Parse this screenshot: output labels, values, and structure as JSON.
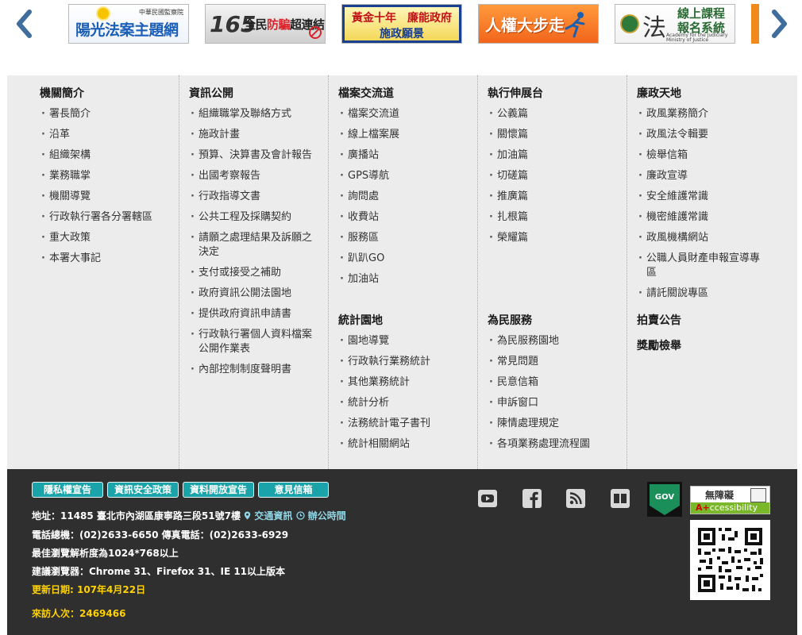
{
  "carousel": {
    "prev_icon": "chevron-left-icon",
    "next_icon": "chevron-right-icon",
    "arrow_color": "#3f6d9c",
    "banners": [
      {
        "small": "中華民國監察院",
        "main": "陽光法案主題網"
      },
      {
        "num": "165",
        "main_a": "全民",
        "main_b": "防騙",
        "main_c": "超連結"
      },
      {
        "line1": "黃金十年　廉能政府",
        "line2": "施政願景"
      },
      {
        "main": "人權大步走"
      },
      {
        "law": "法",
        "title": "線上課程",
        "title2": "報名系統",
        "en1": "Academy for the Judiciary",
        "en2": "Ministry of Justice"
      }
    ]
  },
  "sitemap": {
    "columns": [
      {
        "groups": [
          {
            "heading": "機關簡介",
            "items": [
              "署長簡介",
              "沿革",
              "組織架構",
              "業務職掌",
              "機關導覽",
              "行政執行署各分署轄區",
              "重大政策",
              "本署大事記"
            ]
          }
        ]
      },
      {
        "groups": [
          {
            "heading": "資訊公開",
            "items": [
              "組織職掌及聯絡方式",
              "施政計畫",
              "預算、決算書及會計報告",
              "出國考察報告",
              "行政指導文書",
              "公共工程及採購契約",
              "請願之處理結果及訴願之決定",
              "支付或接受之補助",
              "政府資訊公開法園地",
              "提供政府資訊申請書",
              "行政執行署個人資料檔案公開作業表",
              "內部控制制度聲明書"
            ]
          }
        ]
      },
      {
        "groups": [
          {
            "heading": "檔案交流道",
            "items": [
              "檔案交流道",
              "線上檔案展",
              "廣播站",
              "GPS導航",
              "詢問處",
              "收費站",
              "服務區",
              "趴趴GO",
              "加油站"
            ]
          },
          {
            "heading": "統計園地",
            "items": [
              "園地導覽",
              "行政執行業務統計",
              "其他業務統計",
              "統計分析",
              "法務統計電子書刊",
              "統計相關網站"
            ]
          }
        ]
      },
      {
        "groups": [
          {
            "heading": "執行伸展台",
            "items": [
              "公義篇",
              "關懷篇",
              "加油篇",
              "切磋篇",
              "推廣篇",
              "扎根篇",
              "榮耀篇"
            ]
          },
          {
            "heading": "為民服務",
            "items": [
              "為民服務園地",
              "常見問題",
              "民意信箱",
              "申訴窗口",
              "陳情處理規定",
              "各項業務處理流程圖"
            ]
          }
        ]
      },
      {
        "groups": [
          {
            "heading": "廉政天地",
            "items": [
              "政風業務簡介",
              "政風法令輯要",
              "檢舉信箱",
              "廉政宣導",
              "安全維護常識",
              "機密維護常識",
              "政風機構網站",
              "公職人員財產申報宣導專區",
              "請託關說專區"
            ]
          },
          {
            "heading": "拍賣公告",
            "items": []
          },
          {
            "heading": "獎勵檢舉",
            "items": []
          }
        ]
      }
    ]
  },
  "footer": {
    "buttons": [
      "隱私權宣告",
      "資訊安全政策",
      "資料開放宣告",
      "意見信箱"
    ],
    "address_prefix": "地址：11485 臺北市內湖區康寧路三段51號7樓",
    "traffic_link": "交通資訊",
    "hours_link": "辦公時間",
    "phone": "電話總機：(02)2633-6650 傳真電話：(02)2633-6929",
    "resolution": "最佳瀏覽解析度為1024*768以上",
    "browsers": "建議瀏覽器：Chrome 31、Firefox 31、IE 11以上版本",
    "updated": "更新日期: 107年4月22日",
    "visitors": "來訪人次：2469466",
    "gov_label": "GOV",
    "accessibility_text": "無障礙",
    "accessibility_badge_a": "A+",
    "accessibility_badge_b": "ccessibility",
    "social_icons": [
      "youtube-icon",
      "facebook-icon",
      "rss-icon",
      "flipboard-icon"
    ],
    "colors": {
      "pill": "#1aa3a9",
      "link": "#8fd6e6",
      "highlight": "#ffd200",
      "background": "#2f2f2f"
    }
  }
}
